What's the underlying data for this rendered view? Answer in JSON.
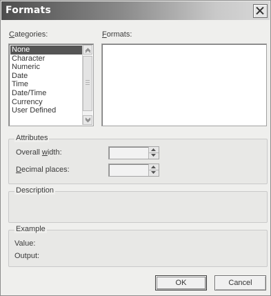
{
  "dialog": {
    "title": "Formats"
  },
  "categories": {
    "label": "Categories:",
    "items": [
      "None",
      "Character",
      "Numeric",
      "Date",
      "Time",
      "Date/Time",
      "Currency",
      "User Defined"
    ],
    "selected": "None"
  },
  "formats": {
    "label": "Formats:"
  },
  "attributes": {
    "legend": "Attributes",
    "overall_width_label": "Overall width:",
    "overall_width_value": "",
    "decimal_places_label": "Decimal places:",
    "decimal_places_value": ""
  },
  "description": {
    "legend": "Description"
  },
  "example": {
    "legend": "Example",
    "value_label": "Value:",
    "output_label": "Output:"
  },
  "buttons": {
    "ok": "OK",
    "cancel": "Cancel"
  },
  "icons": {
    "close": "close-icon",
    "scroll_up": "chevron-up-icon",
    "scroll_down": "chevron-down-icon",
    "spin_up": "arrow-up-icon",
    "spin_down": "arrow-down-icon"
  }
}
